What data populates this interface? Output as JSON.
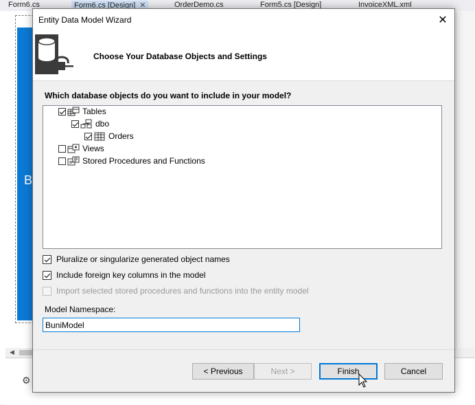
{
  "ide": {
    "tabs": [
      {
        "label": "Form6.cs"
      },
      {
        "label": "Form6.cs [Design]",
        "close": "✕"
      },
      {
        "label": "OrderDemo.cs"
      },
      {
        "label": "Form5.cs [Design]"
      },
      {
        "label": "InvoiceXML.xml"
      }
    ],
    "panel_letter": "B"
  },
  "dialog": {
    "title": "Entity Data Model Wizard",
    "close_glyph": "✕",
    "header_title": "Choose Your Database Objects and Settings",
    "question": "Which database objects do you want to include in your model?",
    "tree": [
      {
        "label": "Tables",
        "checked": true,
        "icon": "tables-icon"
      },
      {
        "label": "dbo",
        "checked": true,
        "icon": "schema-icon"
      },
      {
        "label": "Orders",
        "checked": true,
        "icon": "table-icon"
      },
      {
        "label": "Views",
        "checked": false,
        "icon": "views-icon"
      },
      {
        "label": "Stored Procedures and Functions",
        "checked": false,
        "icon": "stored-procedures-icon"
      }
    ],
    "options": [
      {
        "label": "Pluralize or singularize generated object names",
        "checked": true,
        "enabled": true
      },
      {
        "label": "Include foreign key columns in the model",
        "checked": true,
        "enabled": true
      },
      {
        "label": "Import selected stored procedures and functions into the entity model",
        "checked": false,
        "enabled": false
      }
    ],
    "namespace_label": "Model Namespace:",
    "namespace_value": "BuniModel",
    "buttons": {
      "previous": "< Previous",
      "next": "Next >",
      "finish": "Finish",
      "cancel": "Cancel"
    }
  },
  "colors": {
    "accent": "#0078d7",
    "panel_blue": "#0b7ad6"
  }
}
